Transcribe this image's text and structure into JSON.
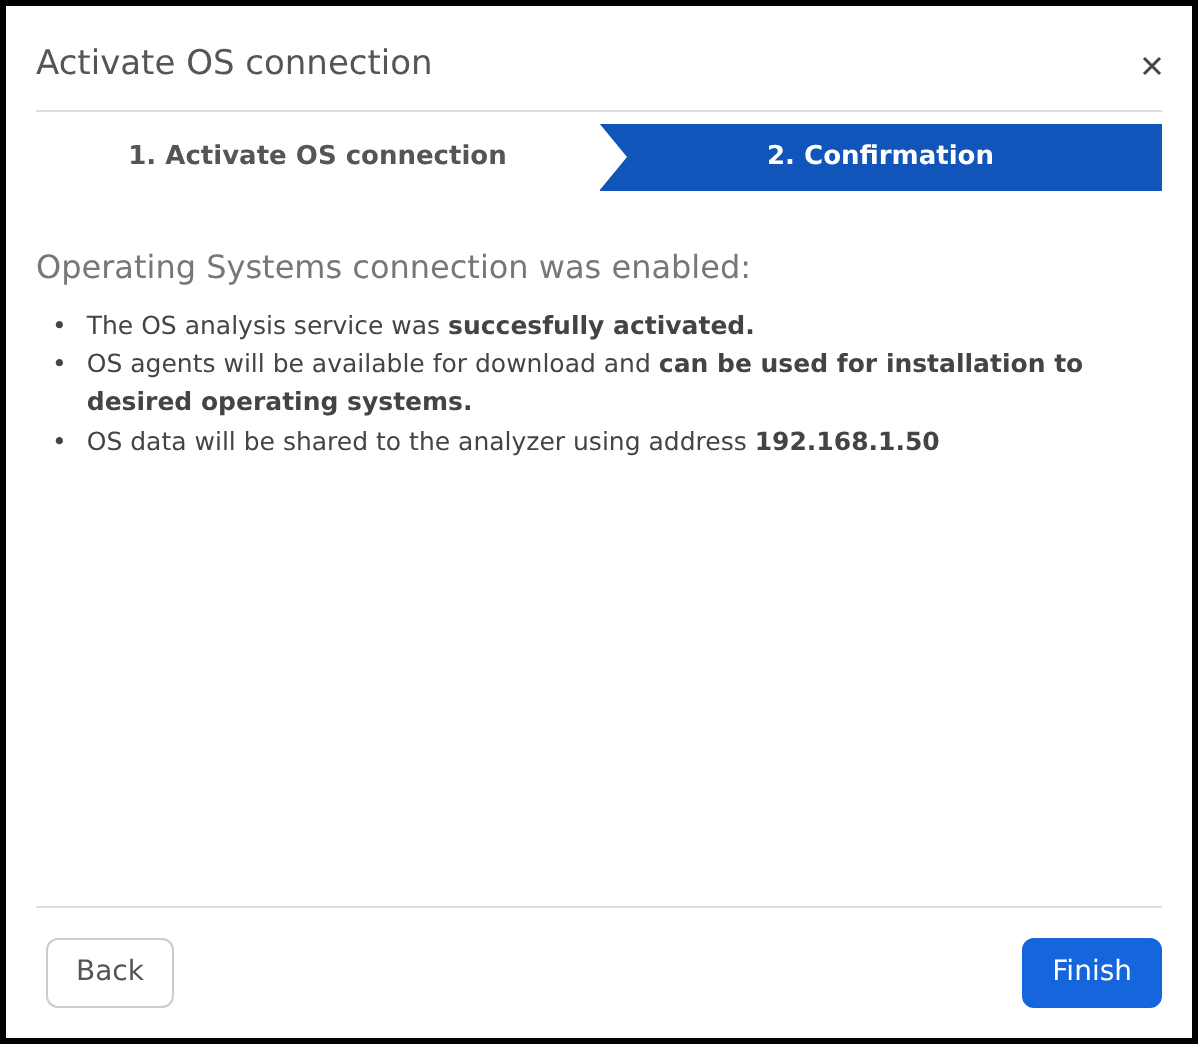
{
  "dialog": {
    "title": "Activate OS connection"
  },
  "steps": [
    {
      "label": "1. Activate OS connection",
      "selected": false
    },
    {
      "label": "2. Confirmation",
      "selected": true
    }
  ],
  "message": {
    "heading": "Operating Systems connection was enabled:",
    "items": [
      {
        "bullet": "•",
        "text": "The OS analysis service was **succesfully activated.**"
      },
      {
        "bullet": "•",
        "text": "OS agents will be available for download and **can be used for installation to desired operating systems.**"
      },
      {
        "bullet": "•",
        "text": "OS data will be shared to the analyzer using address **192.168.1.50**"
      }
    ]
  },
  "buttons": [
    {
      "label": "Back",
      "kind": "secondary"
    },
    {
      "label": "Finish",
      "kind": "primary"
    }
  ]
}
